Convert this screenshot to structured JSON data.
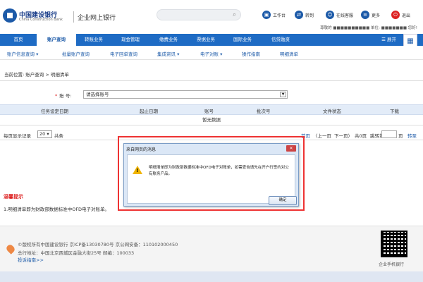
{
  "header": {
    "bank_name": "中国建设银行",
    "bank_en": "China Construction Bank",
    "product": "企业网上银行",
    "actions": [
      {
        "label": "工作台",
        "icon": "desk-icon"
      },
      {
        "label": "转到",
        "icon": "transfer-icon"
      },
      {
        "label": "在线客服",
        "icon": "service-icon"
      },
      {
        "label": "更多",
        "icon": "more-icon"
      },
      {
        "label": "退出",
        "icon": "power-icon"
      }
    ],
    "welcome": "尊敬的 ■■■■■■■■■■ 单位: ■■■■■■■ 您好!"
  },
  "nav": {
    "items": [
      "首页",
      "账户查询",
      "转账业务",
      "现金管理",
      "缴费业务",
      "票据业务",
      "国际业务",
      "信贷融资"
    ],
    "active_index": 1,
    "expand_label": "展开"
  },
  "subnav": {
    "items": [
      "账户信息查询",
      "批量账户查询",
      "电子回单查询",
      "集成资讯",
      "电子对账",
      "操作指南",
      "明细清单"
    ]
  },
  "breadcrumb": "当前位置: 账户查询 > 明细清单",
  "account": {
    "label": "账  号:",
    "value": "请选择账号"
  },
  "table": {
    "columns": [
      "任务设定日期",
      "起止日期",
      "账号",
      "批次号",
      "文件状态",
      "下载"
    ],
    "empty_text": "暂无数据"
  },
  "pager": {
    "page_size_label": "每页显示记录",
    "page_size": "20",
    "total_label": "共条",
    "first": "首页",
    "prev": "〈上一页",
    "next": "下一页〉",
    "info": "共0页",
    "jump_label": "跳转第",
    "page_unit": "页",
    "go": "转至"
  },
  "tips": {
    "title": "温馨提示",
    "text": "1.明细清单即为财政部数据标准中OFD电子对账单。"
  },
  "footer": {
    "copyright": "©版权所有中国建设银行    京ICP备13030780号    京公网安备：110102000450",
    "address": "总行地址：中国北京西城区金融大街25号    邮编：100033",
    "complaint": "投诉指南>>",
    "qr_label": "企业手机银行"
  },
  "modal": {
    "title": "来自网页的消息",
    "message": "明细清单即为财政部数据标准中OFD电子对账单，如需查询请先在开户行签约对公有账务产品。",
    "ok": "确定",
    "close": "✕"
  },
  "colors": {
    "brand": "#1e6bc4",
    "highlight": "#e33"
  }
}
